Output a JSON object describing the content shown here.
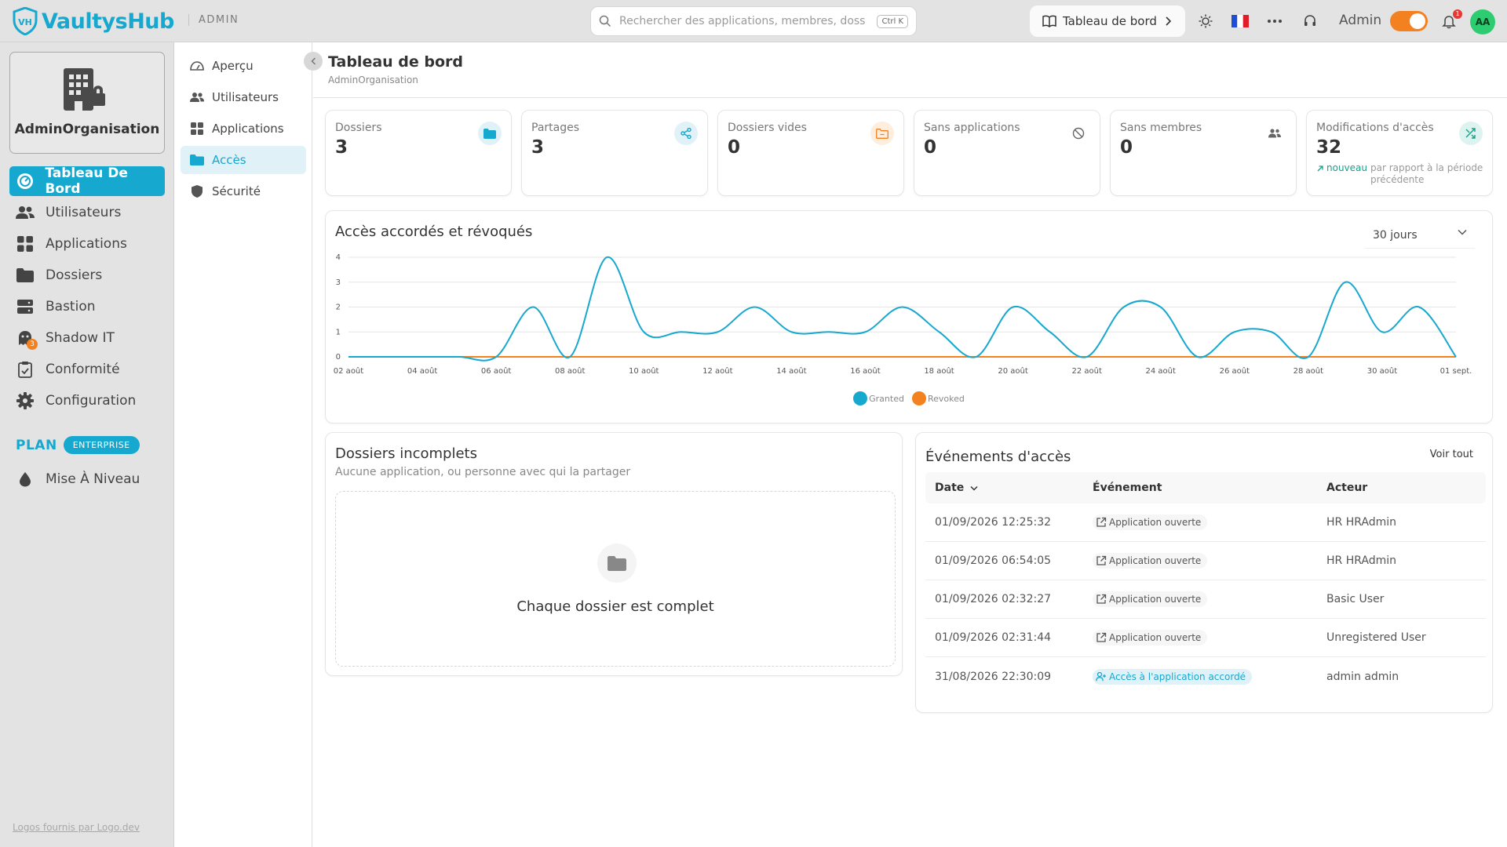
{
  "app": {
    "name": "VaultysHub",
    "section": "ADMIN"
  },
  "search": {
    "placeholder": "Rechercher des applications, membres, doss",
    "shortcut": "Ctrl K"
  },
  "header": {
    "board_button": "Tableau de bord",
    "admin_label": "Admin",
    "notifications_count": "1",
    "avatar_initials": "AA",
    "language_flag": "🇫🇷"
  },
  "sidebar": {
    "org_name": "AdminOrganisation",
    "items": [
      {
        "label": "Tableau De Bord",
        "icon": "dashboard-icon"
      },
      {
        "label": "Utilisateurs",
        "icon": "users-icon"
      },
      {
        "label": "Applications",
        "icon": "grid-icon"
      },
      {
        "label": "Dossiers",
        "icon": "folder-icon"
      },
      {
        "label": "Bastion",
        "icon": "server-icon"
      },
      {
        "label": "Shadow IT",
        "icon": "ghost-icon",
        "badge": "3"
      },
      {
        "label": "Conformité",
        "icon": "clipboard-check-icon"
      },
      {
        "label": "Configuration",
        "icon": "gear-icon"
      }
    ],
    "plan_label": "PLAN",
    "plan_badge": "ENTERPRISE",
    "upgrade": "Mise À Niveau",
    "footer_link": "Logos fournis par Logo.dev"
  },
  "subnav": {
    "items": [
      {
        "label": "Aperçu",
        "icon": "gauge-icon"
      },
      {
        "label": "Utilisateurs",
        "icon": "users-icon"
      },
      {
        "label": "Applications",
        "icon": "grid-icon"
      },
      {
        "label": "Accès",
        "icon": "folder-icon"
      },
      {
        "label": "Sécurité",
        "icon": "shield-icon"
      }
    ]
  },
  "page": {
    "title": "Tableau de bord",
    "subtitle": "AdminOrganisation"
  },
  "stats": [
    {
      "label": "Dossiers",
      "value": "3",
      "icon": "folder-icon",
      "icon_color": "#17a8cf"
    },
    {
      "label": "Partages",
      "value": "3",
      "icon": "share-icon",
      "icon_color": "#17a8cf"
    },
    {
      "label": "Dossiers vides",
      "value": "0",
      "icon": "folder-empty-icon",
      "icon_color": "#f4811f"
    },
    {
      "label": "Sans applications",
      "value": "0",
      "icon": "ban-icon",
      "icon_color": "#666666"
    },
    {
      "label": "Sans membres",
      "value": "0",
      "icon": "users-icon",
      "icon_color": "#666666"
    },
    {
      "label": "Modifications d'accès",
      "value": "32",
      "icon": "shuffle-icon",
      "icon_color": "#17a08c",
      "trend": "nouveau",
      "trend_note": "par rapport à la période précédente"
    }
  ],
  "access_chart": {
    "title": "Accès accordés et révoqués",
    "range": "30 jours"
  },
  "chart_data": {
    "type": "line",
    "x": [
      "02 août",
      "03 août",
      "04 août",
      "05 août",
      "06 août",
      "07 août",
      "08 août",
      "09 août",
      "10 août",
      "11 août",
      "12 août",
      "13 août",
      "14 août",
      "15 août",
      "16 août",
      "17 août",
      "18 août",
      "19 août",
      "20 août",
      "21 août",
      "22 août",
      "23 août",
      "24 août",
      "25 août",
      "26 août",
      "27 août",
      "28 août",
      "29 août",
      "30 août",
      "31 août",
      "01 sept."
    ],
    "tick_labels": [
      "02 août",
      "04 août",
      "06 août",
      "08 août",
      "10 août",
      "12 août",
      "14 août",
      "16 août",
      "18 août",
      "20 août",
      "22 août",
      "24 août",
      "26 août",
      "28 août",
      "30 août",
      "01 sept."
    ],
    "series": [
      {
        "name": "Granted",
        "color": "#17a8cf",
        "values": [
          0,
          0,
          0,
          0,
          0,
          2,
          0,
          4,
          1,
          1,
          1,
          2,
          1,
          1,
          1,
          2,
          1,
          0,
          2,
          1,
          0,
          2,
          2,
          0,
          1,
          1,
          0,
          3,
          1,
          2,
          0
        ]
      },
      {
        "name": "Revoked",
        "color": "#f4811f",
        "values": [
          0,
          0,
          0,
          0,
          0,
          0,
          0,
          0,
          0,
          0,
          0,
          0,
          0,
          0,
          0,
          0,
          0,
          0,
          0,
          0,
          0,
          0,
          0,
          0,
          0,
          0,
          0,
          0,
          0,
          0,
          0
        ]
      }
    ],
    "ylim": [
      0,
      4
    ],
    "yticks": [
      0,
      1,
      2,
      3,
      4
    ],
    "grid": true,
    "legend": "bottom"
  },
  "incomplete": {
    "title": "Dossiers incomplets",
    "subtitle": "Aucune application, ou personne avec qui la partager",
    "empty_text": "Chaque dossier est complet"
  },
  "events": {
    "title": "Événements d'accès",
    "see_all": "Voir tout",
    "columns": {
      "date": "Date",
      "event": "Événement",
      "actor": "Acteur"
    },
    "rows": [
      {
        "date": "01/09/2026 12:25:32",
        "event": "Application ouverte",
        "actor": "HR HRAdmin",
        "kind": "open"
      },
      {
        "date": "01/09/2026 06:54:05",
        "event": "Application ouverte",
        "actor": "HR HRAdmin",
        "kind": "open"
      },
      {
        "date": "01/09/2026 02:32:27",
        "event": "Application ouverte",
        "actor": "Basic User",
        "kind": "open"
      },
      {
        "date": "01/09/2026 02:31:44",
        "event": "Application ouverte",
        "actor": "Unregistered User",
        "kind": "open"
      },
      {
        "date": "31/08/2026 22:30:09",
        "event": "Accès à l'application accordé",
        "actor": "admin admin",
        "kind": "granted"
      }
    ]
  }
}
